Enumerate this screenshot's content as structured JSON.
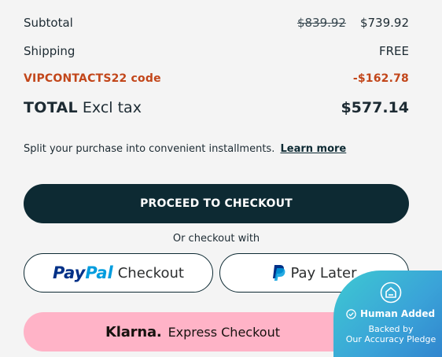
{
  "summary": {
    "subtotal_label": "Subtotal",
    "subtotal_original": "$839.92",
    "subtotal_value": "$739.92",
    "shipping_label": "Shipping",
    "shipping_value": "FREE",
    "discount_label": "VIPCONTACTS22 code",
    "discount_value": "-$162.78",
    "total_label_bold": "TOTAL",
    "total_label_suffix": "Excl tax",
    "total_value": "$577.14"
  },
  "installments": {
    "text": "Split your purchase into convenient installments.",
    "link": "Learn more"
  },
  "buttons": {
    "checkout": "PROCEED TO CHECKOUT",
    "or_checkout": "Or checkout with",
    "paypal_pay": "Pay",
    "paypal_pal": "Pal",
    "paypal_checkout": "Checkout",
    "pay_later": "Pay Later",
    "klarna_logo": "Klarna.",
    "klarna_text": "Express Checkout"
  },
  "badge": {
    "title": "Human Added",
    "line1": "Backed by",
    "line2": "Our Accuracy Pledge"
  },
  "colors": {
    "primary": "#0d2a33",
    "discount": "#c2461a",
    "klarna": "#ffb3c7",
    "paypal_dark": "#003087",
    "paypal_light": "#009cde"
  }
}
